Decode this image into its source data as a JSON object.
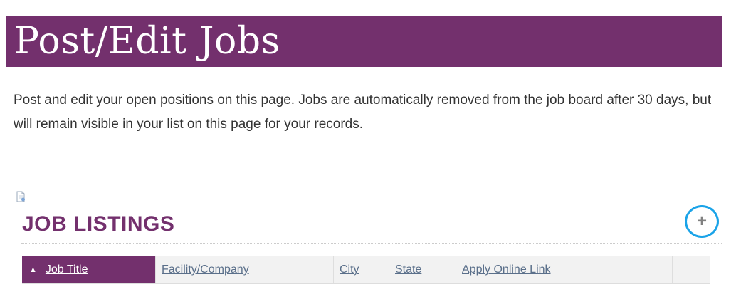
{
  "banner": {
    "title": "Post/Edit Jobs"
  },
  "intro": {
    "text": "Post and edit your open positions on this page. Jobs are automatically removed from the job board after 30 days, but will remain visible in your list on this page for your records."
  },
  "listings": {
    "title": "JOB LISTINGS",
    "add_icon": "plus-icon",
    "sort_indicator": "▲",
    "columns": [
      "Job Title",
      "Facility/Company",
      "City",
      "State",
      "Apply Online Link",
      "",
      ""
    ],
    "sorted_column": "Job Title"
  },
  "colors": {
    "brand": "#73306d",
    "highlight": "#1aa3e8"
  }
}
